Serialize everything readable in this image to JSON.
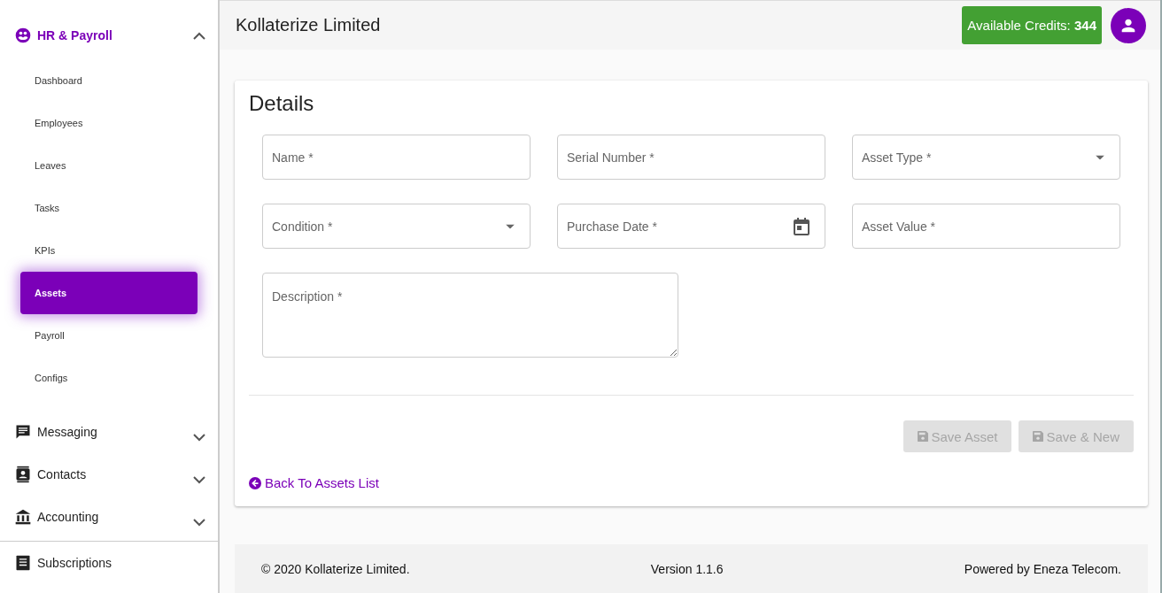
{
  "sidebar": {
    "items": [
      {
        "kind": "group",
        "label": "HR & Payroll",
        "expanded": true,
        "children": [
          {
            "label": "Dashboard",
            "selected": false
          },
          {
            "label": "Employees",
            "selected": false
          },
          {
            "label": "Leaves",
            "selected": false
          },
          {
            "label": "Tasks",
            "selected": false
          },
          {
            "label": "KPIs",
            "selected": false
          },
          {
            "label": "Assets",
            "selected": true
          },
          {
            "label": "Payroll",
            "selected": false
          },
          {
            "label": "Configs",
            "selected": false
          }
        ]
      },
      {
        "kind": "group",
        "label": "Messaging",
        "expanded": false
      },
      {
        "kind": "group",
        "label": "Contacts",
        "expanded": false
      },
      {
        "kind": "group",
        "label": "Accounting",
        "expanded": false
      },
      {
        "kind": "link",
        "label": "Subscriptions"
      }
    ]
  },
  "header": {
    "title": "Kollaterize Limited",
    "credits": "Available Credits: **344**"
  },
  "form": {
    "title": "Details",
    "fields": [
      {
        "kind": "text",
        "placeholder": "Name *"
      },
      {
        "kind": "text",
        "placeholder": "Serial Number *"
      },
      {
        "kind": "select",
        "placeholder": "Asset Type *"
      },
      {
        "kind": "select",
        "placeholder": "Condition *"
      },
      {
        "kind": "date",
        "placeholder": "Purchase Date *"
      },
      {
        "kind": "text",
        "placeholder": "Asset Value *"
      },
      {
        "kind": "textarea",
        "placeholder": "Description *"
      }
    ],
    "buttons": [
      {
        "label": "Save Asset",
        "disabled": true
      },
      {
        "label": "Save & New",
        "disabled": true
      }
    ],
    "back_link": "Back To Assets List"
  },
  "footer": {
    "copyright": "© 2020 Kollaterize Limited.",
    "version": "Version 1.1.6",
    "powered_by": "Powered by Eneza Telecom."
  }
}
